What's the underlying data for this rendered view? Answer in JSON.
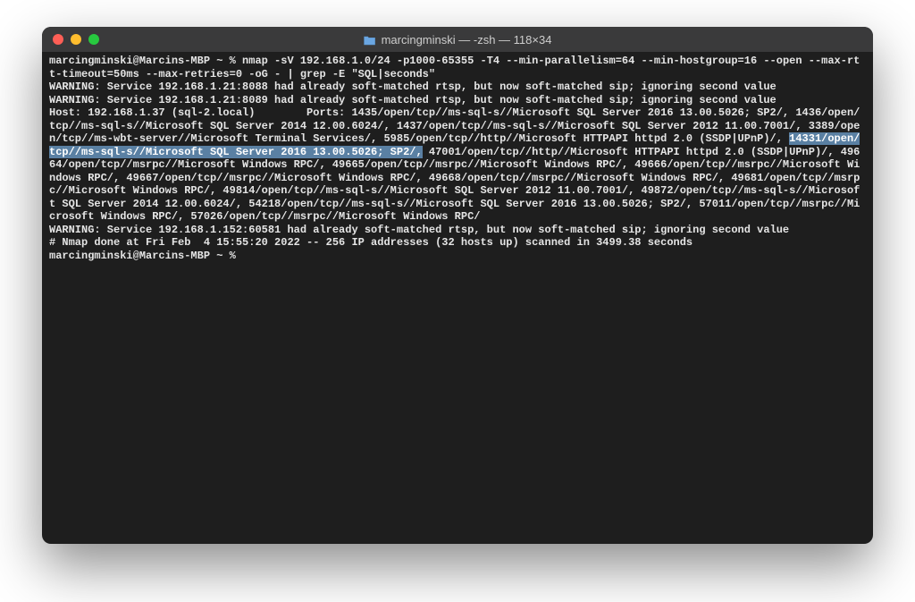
{
  "window": {
    "title": "marcingminski — -zsh — 118×34",
    "folder_icon": "folder"
  },
  "terminal": {
    "prompt1_prefix": "marcingminski@Marcins-MBP ~ % ",
    "command": "nmap -sV 192.168.1.0/24 -p1000-65355 -T4 --min-parallelism=64 --min-hostgroup=16 --open --max-rtt-timeout=50ms --max-retries=0 -oG - | grep -E \"SQL|seconds\"",
    "warn1": "WARNING: Service 192.168.1.21:8088 had already soft-matched rtsp, but now soft-matched sip; ignoring second value",
    "warn2": "WARNING: Service 192.168.1.21:8089 had already soft-matched rtsp, but now soft-matched sip; ignoring second value",
    "host_line_pre": "Host: 192.168.1.37 (sql-2.local)\tPorts: 1435/open/tcp//ms-sql-s//Microsoft SQL Server 2016 13.00.5026; SP2/, 1436/open/tcp//ms-sql-s//Microsoft SQL Server 2014 12.00.6024/, 1437/open/tcp//ms-sql-s//Microsoft SQL Server 2012 11.00.7001/, 3389/open/tcp//ms-wbt-server//Microsoft Terminal Services/, 5985/open/tcp//http//Microsoft HTTPAPI httpd 2.0 (SSDP|UPnP)/, ",
    "host_line_highlight": "14331/open/tcp//ms-sql-s//Microsoft SQL Server 2016 13.00.5026; SP2/,",
    "host_line_post": " 47001/open/tcp//http//Microsoft HTTPAPI httpd 2.0 (SSDP|UPnP)/, 49664/open/tcp//msrpc//Microsoft Windows RPC/, 49665/open/tcp//msrpc//Microsoft Windows RPC/, 49666/open/tcp//msrpc//Microsoft Windows RPC/, 49667/open/tcp//msrpc//Microsoft Windows RPC/, 49668/open/tcp//msrpc//Microsoft Windows RPC/, 49681/open/tcp//msrpc//Microsoft Windows RPC/, 49814/open/tcp//ms-sql-s//Microsoft SQL Server 2012 11.00.7001/, 49872/open/tcp//ms-sql-s//Microsoft SQL Server 2014 12.00.6024/, 54218/open/tcp//ms-sql-s//Microsoft SQL Server 2016 13.00.5026; SP2/, 57011/open/tcp//msrpc//Microsoft Windows RPC/, 57026/open/tcp//msrpc//Microsoft Windows RPC/",
    "warn3": "WARNING: Service 192.168.1.152:60581 had already soft-matched rtsp, but now soft-matched sip; ignoring second value",
    "done": "# Nmap done at Fri Feb  4 15:55:20 2022 -- 256 IP addresses (32 hosts up) scanned in 3499.38 seconds",
    "prompt2": "marcingminski@Marcins-MBP ~ % "
  }
}
